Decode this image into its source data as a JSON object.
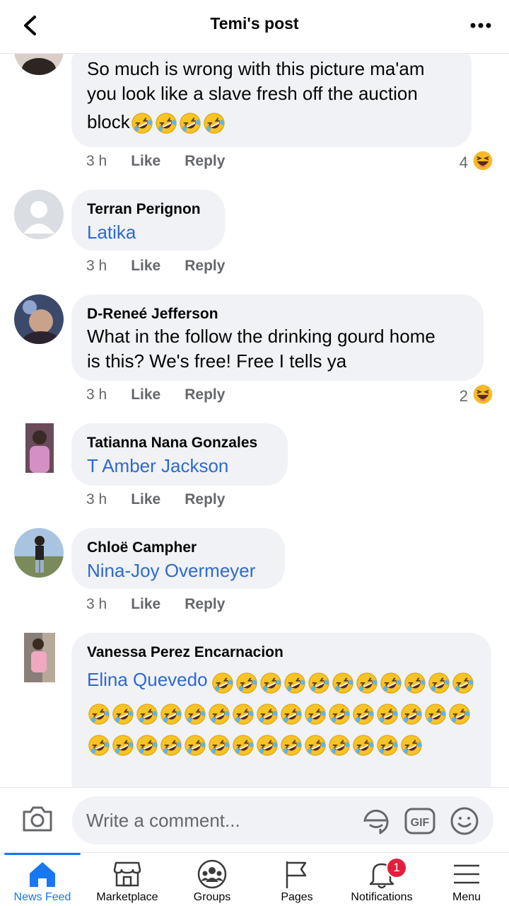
{
  "header": {
    "title": "Temi's post"
  },
  "comments": [
    {
      "text": "So much is wrong with this picture ma'am you look like a slave fresh off the auction block",
      "text_line1": "So much is wrong with this picture ma'am",
      "text_line2": "you look like a slave fresh off the auction",
      "text_line3": "block",
      "emoji_count": 4,
      "time": "3 h",
      "like": "Like",
      "reply": "Reply",
      "reaction_count": "4",
      "reaction": "laughing"
    },
    {
      "author": "Terran Perignon",
      "tag": "Latika",
      "time": "3 h",
      "like": "Like",
      "reply": "Reply"
    },
    {
      "author": "D-Reneé Jefferson",
      "text_line1": "What in the follow the drinking gourd home",
      "text_line2": "is this? We's free! Free I tells ya",
      "time": "3 h",
      "like": "Like",
      "reply": "Reply",
      "reaction_count": "2",
      "reaction": "laughing"
    },
    {
      "author": "Tatianna Nana Gonzales",
      "tag": "T Amber Jackson",
      "time": "3 h",
      "like": "Like",
      "reply": "Reply"
    },
    {
      "author": "Chloë Campher",
      "tag": "Nina-Joy Overmeyer",
      "time": "3 h",
      "like": "Like",
      "reply": "Reply"
    },
    {
      "author": "Vanessa Perez Encarnacion",
      "tag": "Elina Quevedo",
      "emoji_count": 41
    }
  ],
  "comment_bar": {
    "placeholder": "Write a comment..."
  },
  "tabs": [
    {
      "label": "News Feed",
      "icon": "home-icon",
      "active": true
    },
    {
      "label": "Marketplace",
      "icon": "marketplace-icon"
    },
    {
      "label": "Groups",
      "icon": "groups-icon"
    },
    {
      "label": "Pages",
      "icon": "flag-icon"
    },
    {
      "label": "Notifications",
      "icon": "bell-icon",
      "badge": "1"
    },
    {
      "label": "Menu",
      "icon": "menu-icon"
    }
  ],
  "colors": {
    "accent": "#1877f2",
    "link": "#2d6ad0",
    "bubble": "#f0f2f5",
    "badge": "#e41e3f"
  }
}
